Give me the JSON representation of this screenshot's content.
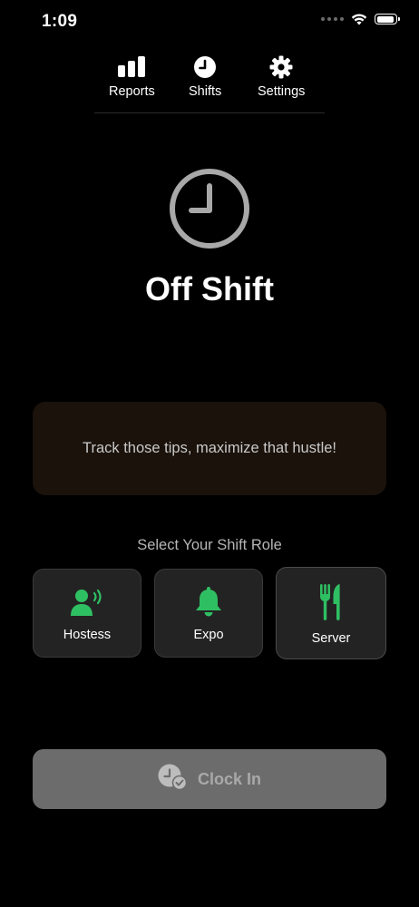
{
  "status_bar": {
    "time": "1:09"
  },
  "nav": {
    "items": [
      {
        "label": "Reports",
        "icon": "bar-chart-icon"
      },
      {
        "label": "Shifts",
        "icon": "clock-icon"
      },
      {
        "label": "Settings",
        "icon": "gear-icon"
      }
    ]
  },
  "hero": {
    "icon": "clock-icon",
    "status": "Off Shift"
  },
  "tagline": "Track those tips, maximize that hustle!",
  "roles": {
    "heading": "Select Your Shift Role",
    "items": [
      {
        "label": "Hostess",
        "icon": "person-speaking-icon"
      },
      {
        "label": "Expo",
        "icon": "bell-icon"
      },
      {
        "label": "Server",
        "icon": "fork-knife-icon"
      }
    ]
  },
  "clock_in": {
    "label": "Clock In",
    "icon": "clock-check-icon"
  },
  "colors": {
    "background": "#000000",
    "accent_green": "#2fbf63",
    "card_brown": "#1a120b",
    "role_button": "#232323",
    "clock_in_disabled": "#6c6c6c"
  }
}
